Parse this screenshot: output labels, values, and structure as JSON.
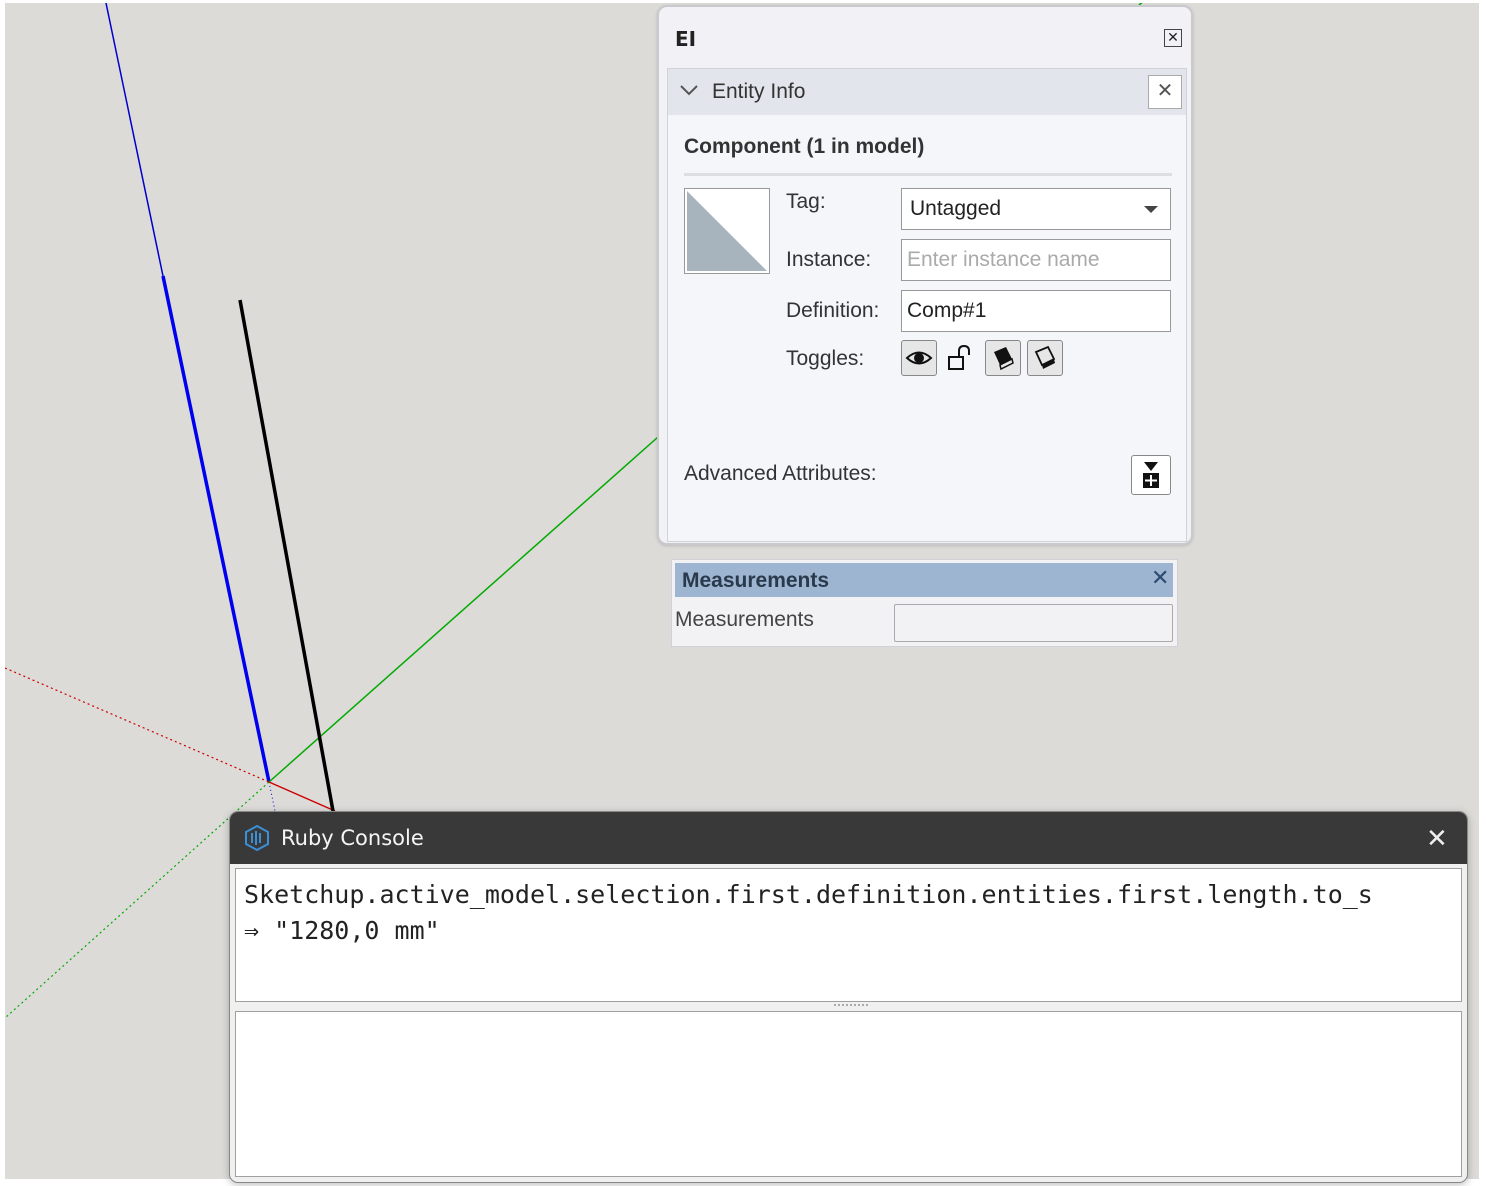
{
  "entity_info": {
    "window_title": "EI",
    "panel_title": "Entity Info",
    "component_heading": "Component (1 in model)",
    "tag_label": "Tag:",
    "tag_value": "Untagged",
    "instance_label": "Instance:",
    "instance_placeholder": "Enter instance name",
    "instance_value": "",
    "definition_label": "Definition:",
    "definition_value": "Comp#1",
    "toggles_label": "Toggles:",
    "toggles": [
      "eye-icon",
      "unlock-icon",
      "receive-shadows-icon",
      "cast-shadows-icon"
    ],
    "advanced_label": "Advanced Attributes:"
  },
  "measurements": {
    "title": "Measurements",
    "label": "Measurements",
    "value": ""
  },
  "ruby_console": {
    "title": "Ruby Console",
    "output_line1": "Sketchup.active_model.selection.first.definition.entities.first.length.to_s",
    "output_line2": "⇒ \"1280,0 mm\"",
    "input_value": ""
  },
  "colors": {
    "viewport_bg": "#dcdbd8",
    "axis_blue": "#0000cc",
    "axis_green": "#00aa00",
    "axis_red": "#cc0000",
    "edge_black": "#000000",
    "ruby_titlebar": "#393939",
    "measurements_header": "#9db5d1"
  }
}
